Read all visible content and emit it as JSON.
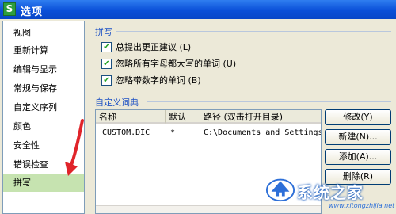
{
  "window": {
    "icon_letter": "S",
    "title": "选项"
  },
  "sidebar": {
    "items": [
      {
        "label": "视图"
      },
      {
        "label": "重新计算"
      },
      {
        "label": "编辑与显示"
      },
      {
        "label": "常规与保存"
      },
      {
        "label": "自定义序列"
      },
      {
        "label": "颜色"
      },
      {
        "label": "安全性"
      },
      {
        "label": "错误检查"
      },
      {
        "label": "拼写"
      }
    ],
    "selected_index": 8,
    "selected_color": "#c6e3b0"
  },
  "spelling": {
    "group_title": "拼写",
    "options": [
      {
        "label": "总提出更正建议",
        "shortcut": "(L)",
        "checked": true
      },
      {
        "label": "忽略所有字母都大写的单词",
        "shortcut": "(U)",
        "checked": true
      },
      {
        "label": "忽略带数字的单词",
        "shortcut": "(B)",
        "checked": true
      }
    ]
  },
  "dictionary": {
    "group_title": "自定义词典",
    "columns": [
      "名称",
      "默认",
      "路径 (双击打开目录)"
    ],
    "rows": [
      {
        "name": "CUSTOM.DIC",
        "default": "*",
        "path": "C:\\Documents and Settings\\"
      }
    ]
  },
  "buttons": {
    "modify": "修改(Y)",
    "new": "新建(N)...",
    "add": "添加(A)...",
    "delete": "删除(R)"
  },
  "watermark": {
    "text": "系统之家",
    "url": "www.xitongzhijia.net"
  },
  "colors": {
    "title_bar": "#0a4fd8",
    "group_title": "#1d51c4",
    "arrow": "#e0242a"
  }
}
